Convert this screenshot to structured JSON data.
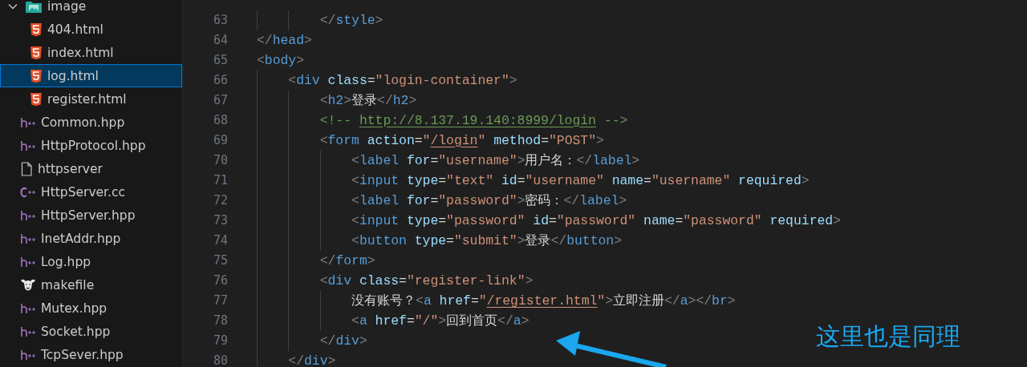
{
  "sidebar": {
    "items": [
      {
        "name": "image",
        "kind": "image-folder",
        "expanded": true,
        "selected": false,
        "children": [
          {
            "name": "404.html",
            "kind": "html",
            "selected": false
          },
          {
            "name": "index.html",
            "kind": "html",
            "selected": false
          },
          {
            "name": "log.html",
            "kind": "html",
            "selected": true
          },
          {
            "name": "register.html",
            "kind": "html",
            "selected": false
          }
        ]
      },
      {
        "name": "Common.hpp",
        "kind": "cpp-header",
        "selected": false
      },
      {
        "name": "HttpProtocol.hpp",
        "kind": "cpp-header",
        "selected": false
      },
      {
        "name": "httpserver",
        "kind": "plain",
        "selected": false
      },
      {
        "name": "HttpServer.cc",
        "kind": "cpp",
        "selected": false
      },
      {
        "name": "HttpServer.hpp",
        "kind": "cpp-header",
        "selected": false
      },
      {
        "name": "InetAddr.hpp",
        "kind": "cpp-header",
        "selected": false
      },
      {
        "name": "Log.hpp",
        "kind": "cpp-header",
        "selected": false
      },
      {
        "name": "makefile",
        "kind": "makefile",
        "selected": false
      },
      {
        "name": "Mutex.hpp",
        "kind": "cpp-header",
        "selected": false
      },
      {
        "name": "Socket.hpp",
        "kind": "cpp-header",
        "selected": false
      },
      {
        "name": "TcpSever.hpp",
        "kind": "cpp-header",
        "selected": false
      }
    ]
  },
  "editor": {
    "lines": [
      {
        "number": "63",
        "tokens": [
          {
            "kind": "punct",
            "text": "        </"
          },
          {
            "kind": "tag",
            "text": "style"
          },
          {
            "kind": "punct",
            "text": ">"
          }
        ]
      },
      {
        "number": "64",
        "tokens": [
          {
            "kind": "punct",
            "text": "</"
          },
          {
            "kind": "tag",
            "text": "head"
          },
          {
            "kind": "punct",
            "text": ">"
          }
        ]
      },
      {
        "number": "65",
        "tokens": [
          {
            "kind": "punct",
            "text": "<"
          },
          {
            "kind": "tag",
            "text": "body"
          },
          {
            "kind": "punct",
            "text": ">"
          }
        ]
      },
      {
        "number": "66",
        "tokens": [
          {
            "kind": "punct",
            "text": "    <"
          },
          {
            "kind": "tag",
            "text": "div"
          },
          {
            "kind": "attr",
            "text": " class"
          },
          {
            "kind": "text",
            "text": "="
          },
          {
            "kind": "string",
            "text": "\"login-container\""
          },
          {
            "kind": "punct",
            "text": ">"
          }
        ]
      },
      {
        "number": "67",
        "tokens": [
          {
            "kind": "punct",
            "text": "        <"
          },
          {
            "kind": "tag",
            "text": "h2"
          },
          {
            "kind": "punct",
            "text": ">"
          },
          {
            "kind": "text",
            "text": "登录"
          },
          {
            "kind": "punct",
            "text": "</"
          },
          {
            "kind": "tag",
            "text": "h2"
          },
          {
            "kind": "punct",
            "text": ">"
          }
        ]
      },
      {
        "number": "68",
        "tokens": [
          {
            "kind": "comment",
            "text": "        <!-- "
          },
          {
            "kind": "comment",
            "text": "http://8.137.19.140:8999/login",
            "underline": true
          },
          {
            "kind": "comment",
            "text": " -->"
          }
        ]
      },
      {
        "number": "69",
        "tokens": [
          {
            "kind": "punct",
            "text": "        <"
          },
          {
            "kind": "tag",
            "text": "form"
          },
          {
            "kind": "attr",
            "text": " action"
          },
          {
            "kind": "text",
            "text": "="
          },
          {
            "kind": "string",
            "text": "\""
          },
          {
            "kind": "string",
            "text": "/login",
            "underline": true
          },
          {
            "kind": "string",
            "text": "\""
          },
          {
            "kind": "attr",
            "text": " method"
          },
          {
            "kind": "text",
            "text": "="
          },
          {
            "kind": "string",
            "text": "\"POST\""
          },
          {
            "kind": "punct",
            "text": ">"
          }
        ]
      },
      {
        "number": "70",
        "tokens": [
          {
            "kind": "punct",
            "text": "            <"
          },
          {
            "kind": "tag",
            "text": "label"
          },
          {
            "kind": "attr",
            "text": " for"
          },
          {
            "kind": "text",
            "text": "="
          },
          {
            "kind": "string",
            "text": "\"username\""
          },
          {
            "kind": "punct",
            "text": ">"
          },
          {
            "kind": "text",
            "text": "用户名："
          },
          {
            "kind": "punct",
            "text": "</"
          },
          {
            "kind": "tag",
            "text": "label"
          },
          {
            "kind": "punct",
            "text": ">"
          }
        ]
      },
      {
        "number": "71",
        "tokens": [
          {
            "kind": "punct",
            "text": "            <"
          },
          {
            "kind": "tag",
            "text": "input"
          },
          {
            "kind": "attr",
            "text": " type"
          },
          {
            "kind": "text",
            "text": "="
          },
          {
            "kind": "string",
            "text": "\"text\""
          },
          {
            "kind": "attr",
            "text": " id"
          },
          {
            "kind": "text",
            "text": "="
          },
          {
            "kind": "string",
            "text": "\"username\""
          },
          {
            "kind": "attr",
            "text": " name"
          },
          {
            "kind": "text",
            "text": "="
          },
          {
            "kind": "string",
            "text": "\"username\""
          },
          {
            "kind": "attr",
            "text": " required"
          },
          {
            "kind": "punct",
            "text": ">"
          }
        ]
      },
      {
        "number": "72",
        "tokens": [
          {
            "kind": "punct",
            "text": "            <"
          },
          {
            "kind": "tag",
            "text": "label"
          },
          {
            "kind": "attr",
            "text": " for"
          },
          {
            "kind": "text",
            "text": "="
          },
          {
            "kind": "string",
            "text": "\"password\""
          },
          {
            "kind": "punct",
            "text": ">"
          },
          {
            "kind": "text",
            "text": "密码："
          },
          {
            "kind": "punct",
            "text": "</"
          },
          {
            "kind": "tag",
            "text": "label"
          },
          {
            "kind": "punct",
            "text": ">"
          }
        ]
      },
      {
        "number": "73",
        "tokens": [
          {
            "kind": "punct",
            "text": "            <"
          },
          {
            "kind": "tag",
            "text": "input"
          },
          {
            "kind": "attr",
            "text": " type"
          },
          {
            "kind": "text",
            "text": "="
          },
          {
            "kind": "string",
            "text": "\"password\""
          },
          {
            "kind": "attr",
            "text": " id"
          },
          {
            "kind": "text",
            "text": "="
          },
          {
            "kind": "string",
            "text": "\"password\""
          },
          {
            "kind": "attr",
            "text": " name"
          },
          {
            "kind": "text",
            "text": "="
          },
          {
            "kind": "string",
            "text": "\"password\""
          },
          {
            "kind": "attr",
            "text": " required"
          },
          {
            "kind": "punct",
            "text": ">"
          }
        ]
      },
      {
        "number": "74",
        "tokens": [
          {
            "kind": "punct",
            "text": "            <"
          },
          {
            "kind": "tag",
            "text": "button"
          },
          {
            "kind": "attr",
            "text": " type"
          },
          {
            "kind": "text",
            "text": "="
          },
          {
            "kind": "string",
            "text": "\"submit\""
          },
          {
            "kind": "punct",
            "text": ">"
          },
          {
            "kind": "text",
            "text": "登录"
          },
          {
            "kind": "punct",
            "text": "</"
          },
          {
            "kind": "tag",
            "text": "button"
          },
          {
            "kind": "punct",
            "text": ">"
          }
        ]
      },
      {
        "number": "75",
        "tokens": [
          {
            "kind": "punct",
            "text": "        </"
          },
          {
            "kind": "tag",
            "text": "form"
          },
          {
            "kind": "punct",
            "text": ">"
          }
        ]
      },
      {
        "number": "76",
        "tokens": [
          {
            "kind": "punct",
            "text": "        <"
          },
          {
            "kind": "tag",
            "text": "div"
          },
          {
            "kind": "attr",
            "text": " class"
          },
          {
            "kind": "text",
            "text": "="
          },
          {
            "kind": "string",
            "text": "\"register-link\""
          },
          {
            "kind": "punct",
            "text": ">"
          }
        ]
      },
      {
        "number": "77",
        "tokens": [
          {
            "kind": "text",
            "text": "            没有账号？"
          },
          {
            "kind": "punct",
            "text": "<"
          },
          {
            "kind": "tag",
            "text": "a"
          },
          {
            "kind": "attr",
            "text": " href"
          },
          {
            "kind": "text",
            "text": "="
          },
          {
            "kind": "string",
            "text": "\""
          },
          {
            "kind": "string",
            "text": "/register.html",
            "underline": true
          },
          {
            "kind": "string",
            "text": "\""
          },
          {
            "kind": "punct",
            "text": ">"
          },
          {
            "kind": "text",
            "text": "立即注册"
          },
          {
            "kind": "punct",
            "text": "</"
          },
          {
            "kind": "tag",
            "text": "a"
          },
          {
            "kind": "punct",
            "text": "></"
          },
          {
            "kind": "tag",
            "text": "br"
          },
          {
            "kind": "punct",
            "text": ">"
          }
        ]
      },
      {
        "number": "78",
        "tokens": [
          {
            "kind": "punct",
            "text": "            <"
          },
          {
            "kind": "tag",
            "text": "a"
          },
          {
            "kind": "attr",
            "text": " href"
          },
          {
            "kind": "text",
            "text": "="
          },
          {
            "kind": "string",
            "text": "\"/\""
          },
          {
            "kind": "punct",
            "text": ">"
          },
          {
            "kind": "text",
            "text": "回到首页"
          },
          {
            "kind": "punct",
            "text": "</"
          },
          {
            "kind": "tag",
            "text": "a"
          },
          {
            "kind": "punct",
            "text": ">"
          }
        ]
      },
      {
        "number": "79",
        "tokens": [
          {
            "kind": "punct",
            "text": "        </"
          },
          {
            "kind": "tag",
            "text": "div"
          },
          {
            "kind": "punct",
            "text": ">"
          }
        ]
      },
      {
        "number": "80",
        "tokens": [
          {
            "kind": "punct",
            "text": "    </"
          },
          {
            "kind": "tag",
            "text": "div"
          },
          {
            "kind": "punct",
            "text": ">"
          }
        ]
      }
    ]
  },
  "annotation": {
    "text": "这里也是同理"
  }
}
